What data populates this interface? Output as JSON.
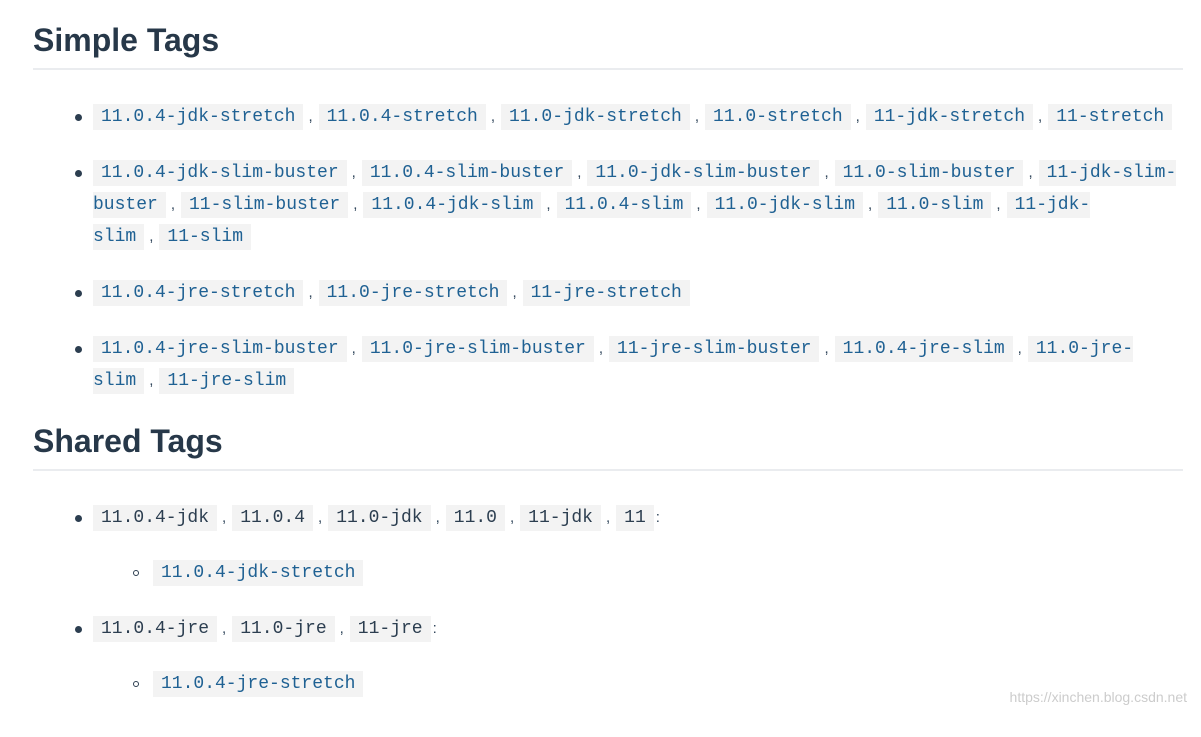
{
  "simple_tags": {
    "heading": "Simple Tags",
    "groups": [
      [
        "11.0.4-jdk-stretch",
        "11.0.4-stretch",
        "11.0-jdk-stretch",
        "11.0-stretch",
        "11-jdk-stretch",
        "11-stretch"
      ],
      [
        "11.0.4-jdk-slim-buster",
        "11.0.4-slim-buster",
        "11.0-jdk-slim-buster",
        "11.0-slim-buster",
        "11-jdk-slim-buster",
        "11-slim-buster",
        "11.0.4-jdk-slim",
        "11.0.4-slim",
        "11.0-jdk-slim",
        "11.0-slim",
        "11-jdk-slim",
        "11-slim"
      ],
      [
        "11.0.4-jre-stretch",
        "11.0-jre-stretch",
        "11-jre-stretch"
      ],
      [
        "11.0.4-jre-slim-buster",
        "11.0-jre-slim-buster",
        "11-jre-slim-buster",
        "11.0.4-jre-slim",
        "11.0-jre-slim",
        "11-jre-slim"
      ]
    ]
  },
  "shared_tags": {
    "heading": "Shared Tags",
    "groups": [
      {
        "tags": [
          "11.0.4-jdk",
          "11.0.4",
          "11.0-jdk",
          "11.0",
          "11-jdk",
          "11"
        ],
        "children": [
          "11.0.4-jdk-stretch"
        ]
      },
      {
        "tags": [
          "11.0.4-jre",
          "11.0-jre",
          "11-jre"
        ],
        "children": [
          "11.0.4-jre-stretch"
        ]
      }
    ]
  },
  "separator": ",",
  "colon": ":",
  "watermark": "https://xinchen.blog.csdn.net"
}
